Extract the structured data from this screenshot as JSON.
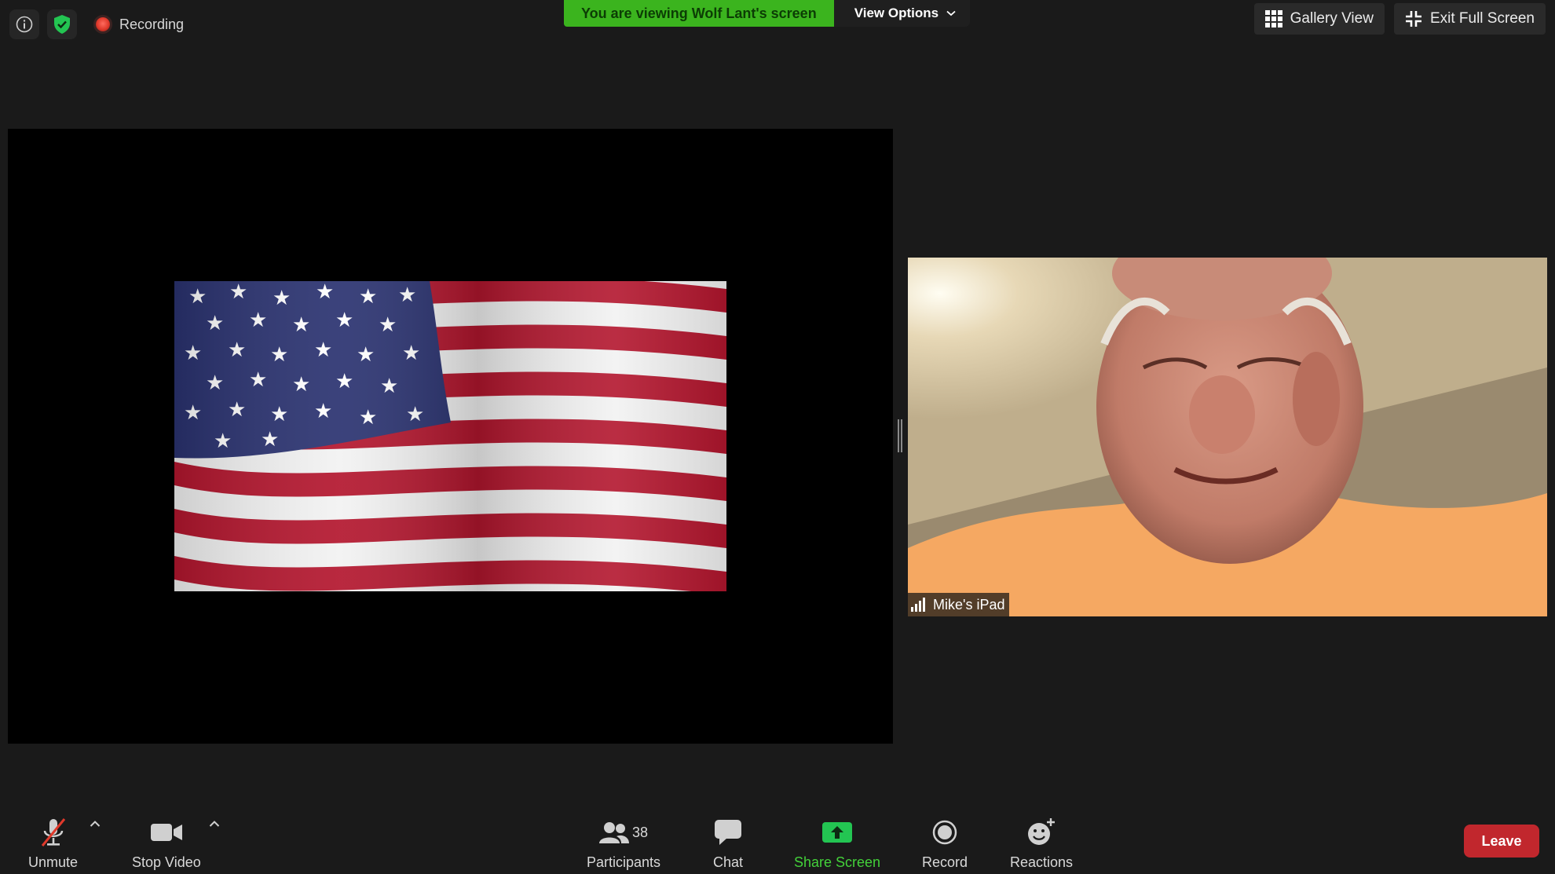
{
  "top": {
    "recording_label": "Recording",
    "viewing_banner": "You are viewing Wolf Lant's screen",
    "view_options": "View Options",
    "gallery_view": "Gallery View",
    "exit_full_screen": "Exit Full Screen"
  },
  "video": {
    "participant_name": "Mike's iPad"
  },
  "toolbar": {
    "unmute": "Unmute",
    "stop_video": "Stop Video",
    "participants": "Participants",
    "participants_count": "38",
    "chat": "Chat",
    "share_screen": "Share Screen",
    "record": "Record",
    "reactions": "Reactions",
    "leave": "Leave"
  },
  "colors": {
    "banner_green": "#3bb41e",
    "share_green": "#43d13a",
    "leave_red": "#c1272d",
    "background": "#1a1a1a"
  }
}
